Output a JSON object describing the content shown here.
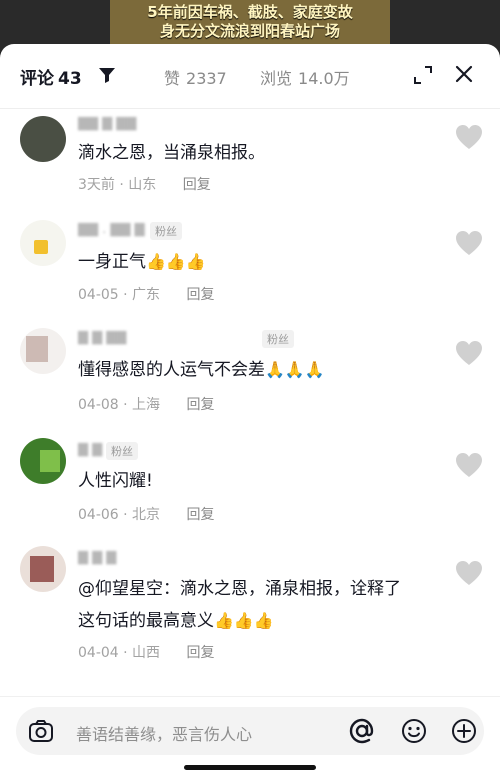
{
  "video_caption": {
    "line1": "5年前因车祸、截肢、家庭变故",
    "line2": "身无分文流浪到阳春站广场"
  },
  "header": {
    "comments_label": "评论",
    "comments_count": "43",
    "likes_label": "赞",
    "likes_count": "2337",
    "views_label": "浏览",
    "views_count": "14.0万"
  },
  "comments": [
    {
      "username": "▇▇ ▇ ▇▇",
      "fan_badge": "",
      "text": "滴水之恩，当涌泉相报。",
      "date": "3天前",
      "location": "山东",
      "reply": "回复"
    },
    {
      "username": "▇▇ . ▇▇ ▇",
      "fan_badge": "粉丝",
      "text": "一身正气",
      "emojis": "👍👍👍",
      "date": "04-05",
      "location": "广东",
      "reply": "回复"
    },
    {
      "username": "▇ ▇ ▇▇",
      "fan_badge": "粉丝",
      "text": "懂得感恩的人运气不会差",
      "emojis": "🙏🙏🙏",
      "date": "04-08",
      "location": "上海",
      "reply": "回复"
    },
    {
      "username": "▇ ▇",
      "fan_badge": "粉丝",
      "text": "人性闪耀!",
      "date": "04-06",
      "location": "北京",
      "reply": "回复"
    },
    {
      "username": "▇ ▇ ▇",
      "fan_badge": "",
      "text_line1": "@仰望星空：滴水之恩，涌泉相报，诠释了",
      "text_line2": "这句话的最高意义",
      "emojis": "👍👍👍",
      "date": "04-04",
      "location": "山西",
      "reply": "回复"
    }
  ],
  "input": {
    "placeholder": "善语结善缘，恶言伤人心"
  }
}
